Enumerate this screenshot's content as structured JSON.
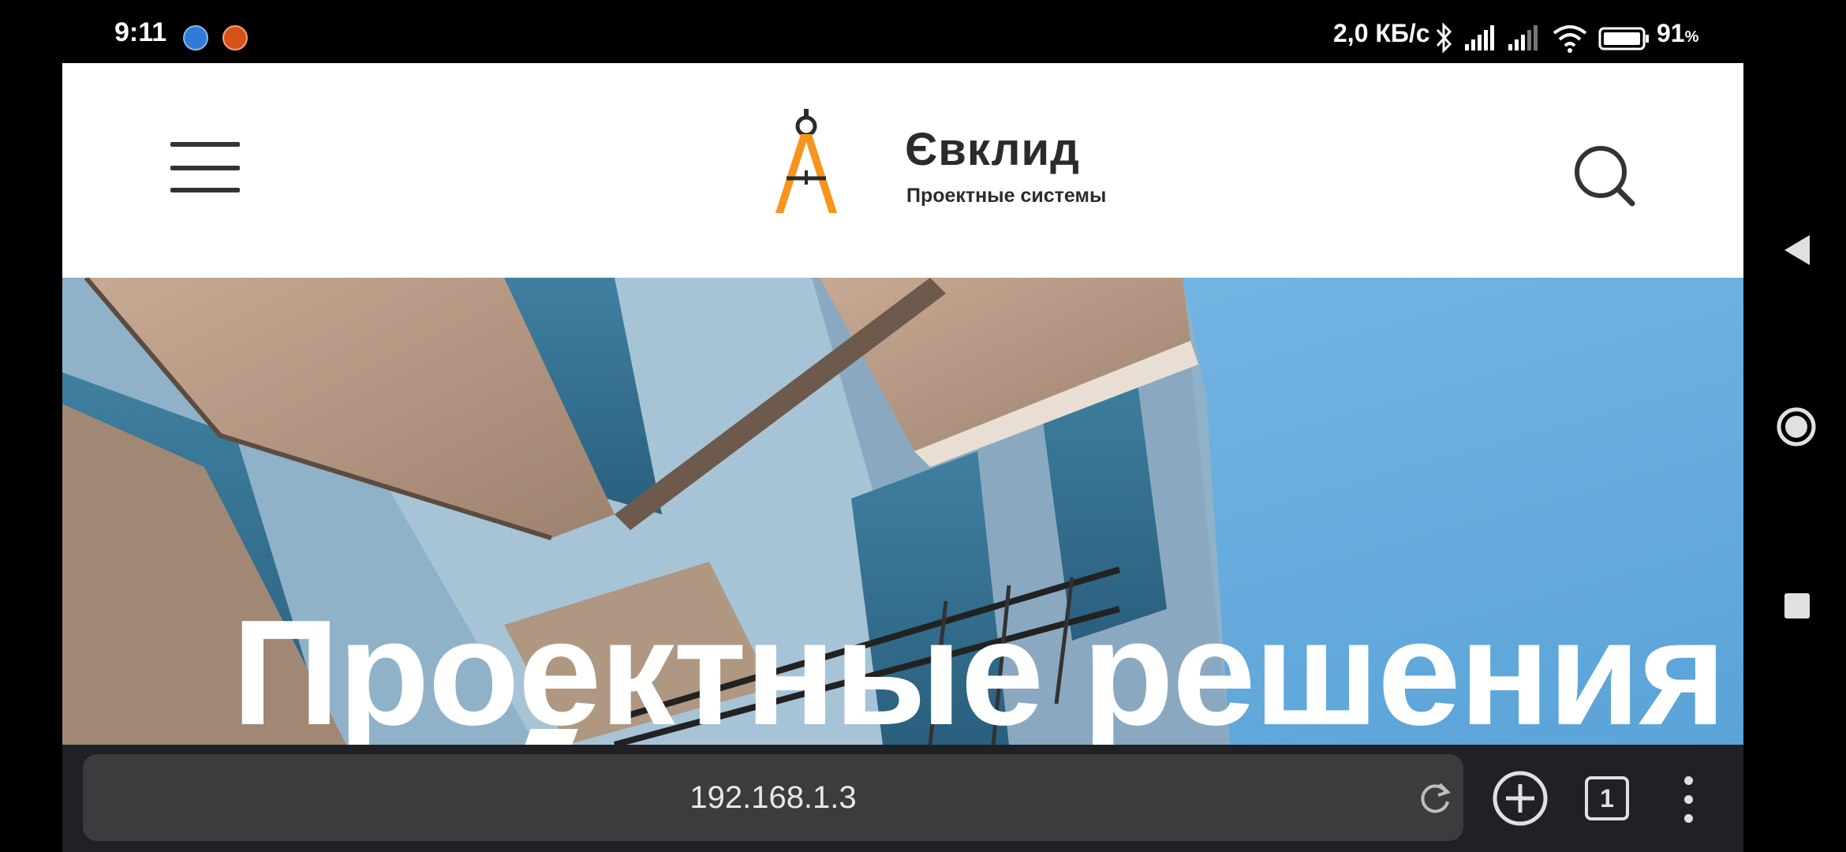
{
  "status_bar": {
    "time": "9:11",
    "network_speed": "2,0 КБ/с",
    "battery_percent": "91",
    "battery_unit": "%",
    "icons": [
      "activity-app-icon",
      "orange-app-icon",
      "bluetooth-icon",
      "signal-icon",
      "signal-icon",
      "wifi-icon",
      "battery-icon"
    ]
  },
  "site": {
    "logo_title": "Євклид",
    "logo_subtitle": "Проектные системы",
    "hero_title": "Проектные решения",
    "colors": {
      "logo_orange": "#f7941d",
      "sky": "#6fb3e4",
      "facade": "#b89a85",
      "text_dark": "#2b2b2b"
    }
  },
  "browser": {
    "url": "192.168.1.3",
    "tab_count": "1"
  },
  "nav": [
    "back-icon",
    "home-icon",
    "recents-icon"
  ]
}
